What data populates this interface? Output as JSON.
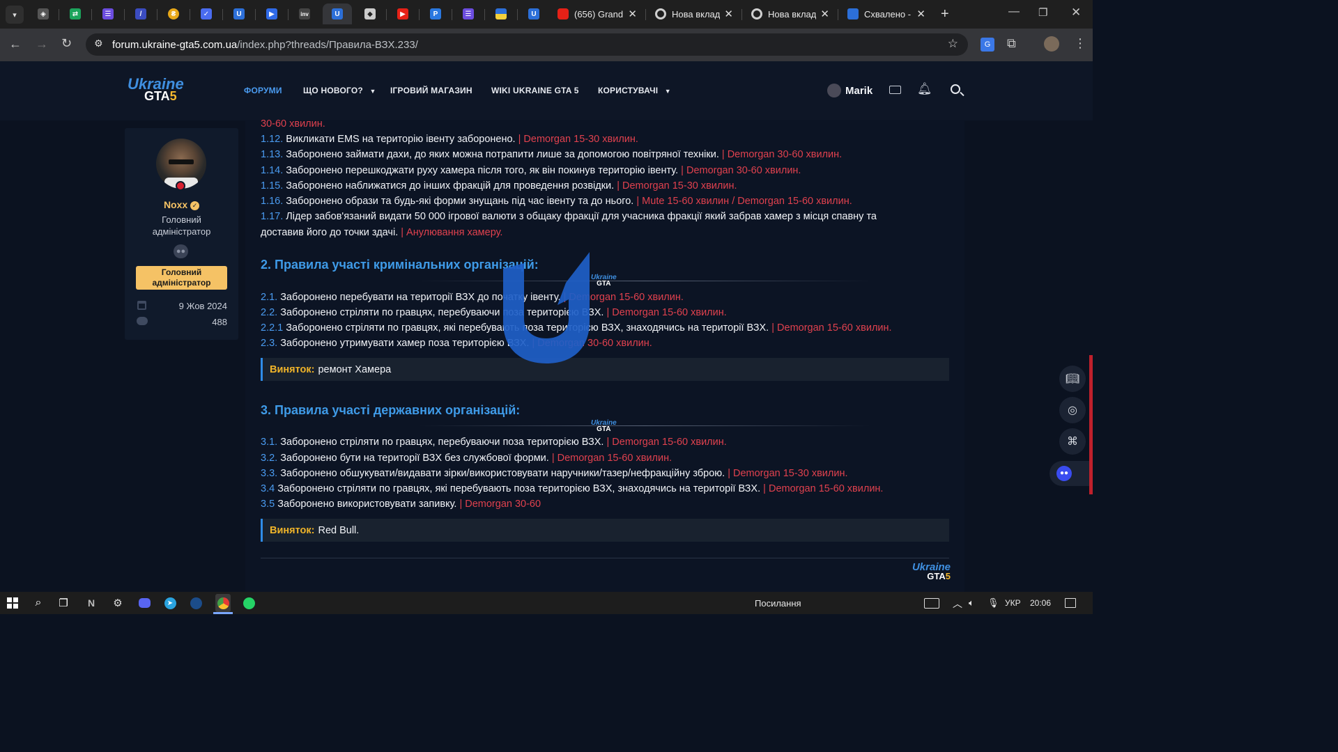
{
  "browser": {
    "tabs": [
      {
        "title": "(656) Grand",
        "favicon": "youtube-icon"
      },
      {
        "title": "Нова вклад",
        "favicon": "chrome-icon"
      },
      {
        "title": "Нова вклад",
        "favicon": "chrome-icon"
      },
      {
        "title": "Схвалено -",
        "favicon": "ukraine-gta-icon"
      }
    ],
    "url_host": "forum.ukraine-gta5.com.ua",
    "url_path": "/index.php?threads/Правила-ВЗХ.233/"
  },
  "site": {
    "logo": {
      "top": "Ukraine",
      "bottom": "GTA",
      "num": "5"
    },
    "nav": [
      "ФОРУМИ",
      "ЩО НОВОГО?",
      "ІГРОВИЙ МАГАЗИН",
      "WIKI UKRAINE GTA 5",
      "КОРИСТУВАЧІ"
    ],
    "username": "Marik"
  },
  "author": {
    "name": "Noxx",
    "title": "Головний адміністратор",
    "badge": "Головний адміністратор",
    "joined": "9 Жов 2024",
    "messages": "488"
  },
  "content": {
    "top_fragment": "30-60 хвилин.",
    "rules_1": [
      {
        "num": "1.12.",
        "text": "Викликати EMS на територію івенту заборонено.",
        "penalty": "| Demorgan 15-30 хвилин."
      },
      {
        "num": "1.13.",
        "text": "Заборонено займати дахи, до яких можна потрапити лише за допомогою повітряної техніки.",
        "penalty": "| Demorgan 30-60 хвилин."
      },
      {
        "num": "1.14.",
        "text": "Заборонено перешкоджати руху хамера після того, як він покинув територію івенту.",
        "penalty": "| Demorgan 30-60 хвилин."
      },
      {
        "num": "1.15.",
        "text": "Заборонено наближатися до інших фракцій для проведення розвідки.",
        "penalty": "| Demorgan 15-30 хвилин."
      },
      {
        "num": "1.16.",
        "text": "Заборонено образи та будь-які форми знущань під час івенту та до нього.",
        "penalty": "| Mute 15-60 хвилин / Demorgan 15-60 хвилин."
      }
    ],
    "rule_1_17": {
      "num": "1.17.",
      "text_line1": "Лідер забов'язаний видати 50 000 ігрової валюти з общаку фракції для учасника фракції який забрав хамер з місця спавну та",
      "text_line2": "доставив його до точки здачі.",
      "penalty": "| Анулювання хамеру."
    },
    "section2_title": "2. Правила участі кримінальних організацій:",
    "rules_2": [
      {
        "num": "2.1.",
        "text": "Заборонено перебувати на території ВЗХ до початку івенту.",
        "penalty": "| Demorgan 15-60 хвилин."
      },
      {
        "num": "2.2.",
        "text": "Заборонено стріляти по гравцях, перебуваючи поза територією ВЗХ.",
        "penalty": "| Demorgan 15-60 хвилин."
      },
      {
        "num": "2.2.1",
        "text": "Заборонено стріляти по гравцях, які перебувають поза територією ВЗХ, знаходячись на території ВЗХ.",
        "penalty": "| Demorgan 15-60 хвилин."
      },
      {
        "num": "2.3.",
        "text": "Заборонено утримувати хамер поза територією ВЗХ.",
        "penalty": "| Demorgan 30-60 хвилин."
      }
    ],
    "exception2": {
      "label": "Виняток:",
      "text": "ремонт Хамера"
    },
    "section3_title": "3. Правила участі державних організацій:",
    "rules_3": [
      {
        "num": "3.1.",
        "text": "Заборонено стріляти по гравцях, перебуваючи поза територією ВЗХ.",
        "penalty": "| Demorgan 15-60 хвилин."
      },
      {
        "num": "3.2.",
        "text": "Заборонено бути на території ВЗХ без службової форми.",
        "penalty": "| Demorgan 15-60 хвилин."
      },
      {
        "num": "3.3.",
        "text": "Заборонено обшукувати/видавати зірки/використовувати наручники/тазер/нефракційну зброю.",
        "penalty": "| Demorgan 15-30 хвилин."
      },
      {
        "num": "3.4",
        "text": "Заборонено стріляти по гравцях, які перебувають поза територією ВЗХ, знаходячись на території ВЗХ.",
        "penalty": "| Demorgan 15-60 хвилин."
      },
      {
        "num": "3.5",
        "text": "Заборонено використовувати запивку.",
        "penalty": "| Demorgan 30-60"
      }
    ],
    "exception3": {
      "label": "Виняток:",
      "text": "Red Bull."
    }
  },
  "taskbar": {
    "search_text": "Посилання",
    "lang": "УКР",
    "time": "20:06"
  },
  "colors": {
    "accent": "#4a9bf0",
    "penalty": "#e0414e",
    "exception": "#f0b429",
    "badge": "#f5c265"
  }
}
